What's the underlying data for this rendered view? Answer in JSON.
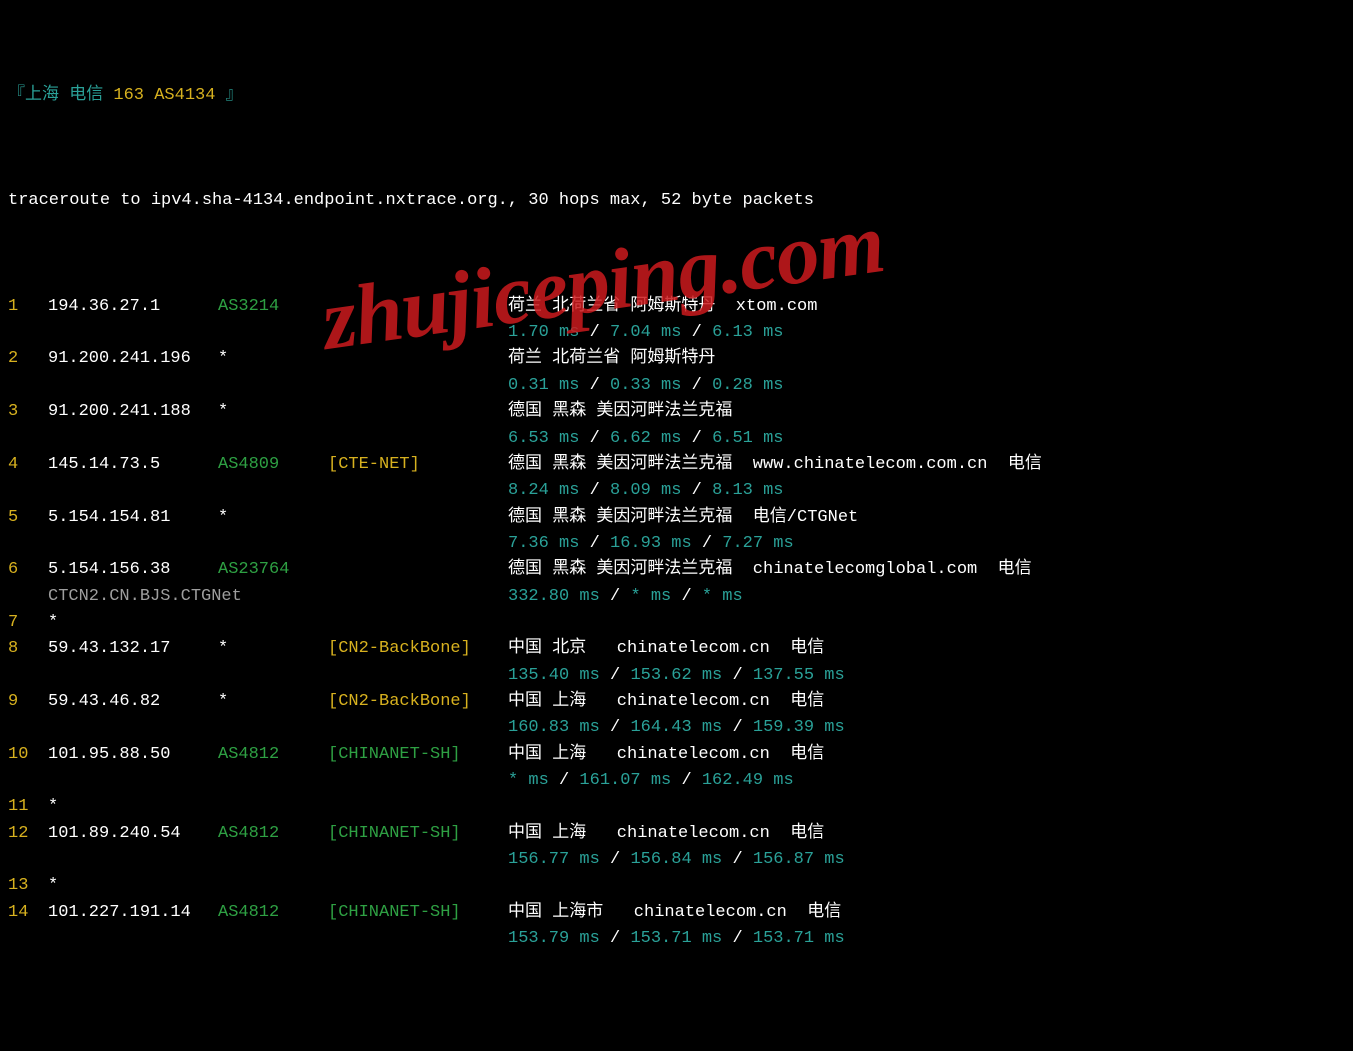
{
  "title_prefix": "『上海 电信 ",
  "title_as": "163 AS4134",
  "title_suffix": " 』",
  "trace_line": "traceroute to ipv4.sha-4134.endpoint.nxtrace.org., 30 hops max, 52 byte packets",
  "watermark": "zhujiceping.com",
  "hops": [
    {
      "n": "1",
      "ip": "194.36.27.1",
      "asn": "AS3214",
      "tag": "",
      "loc": "荷兰 北荷兰省 阿姆斯特丹  xtom.com",
      "lat": [
        "1.70 ms",
        "7.04 ms",
        "6.13 ms"
      ]
    },
    {
      "n": "2",
      "ip": "91.200.241.196",
      "asn": "*",
      "tag": "",
      "loc": "荷兰 北荷兰省 阿姆斯特丹",
      "lat": [
        "0.31 ms",
        "0.33 ms",
        "0.28 ms"
      ]
    },
    {
      "n": "3",
      "ip": "91.200.241.188",
      "asn": "*",
      "tag": "",
      "loc": "德国 黑森 美因河畔法兰克福",
      "lat": [
        "6.53 ms",
        "6.62 ms",
        "6.51 ms"
      ]
    },
    {
      "n": "4",
      "ip": "145.14.73.5",
      "asn": "AS4809",
      "tag": "[CTE-NET]",
      "loc": "德国 黑森 美因河畔法兰克福  www.chinatelecom.com.cn  电信",
      "lat": [
        "8.24 ms",
        "8.09 ms",
        "8.13 ms"
      ]
    },
    {
      "n": "5",
      "ip": "5.154.154.81",
      "asn": "*",
      "tag": "",
      "loc": "德国 黑森 美因河畔法兰克福  电信/CTGNet",
      "lat": [
        "7.36 ms",
        "16.93 ms",
        "7.27 ms"
      ]
    },
    {
      "n": "6",
      "ip": "5.154.156.38",
      "asn": "AS23764",
      "tag": "",
      "loc": "德国 黑森 美因河畔法兰克福  chinatelecomglobal.com  电信",
      "rdns": "CTCN2.CN.BJS.CTGNet",
      "lat": [
        "332.80 ms",
        "* ms",
        "* ms"
      ]
    },
    {
      "n": "7",
      "ip": "*",
      "asn": "",
      "tag": "",
      "loc": "",
      "lat": []
    },
    {
      "n": "8",
      "ip": "59.43.132.17",
      "asn": "*",
      "tag": "[CN2-BackBone]",
      "loc": "中国 北京   chinatelecom.cn  电信",
      "lat": [
        "135.40 ms",
        "153.62 ms",
        "137.55 ms"
      ]
    },
    {
      "n": "9",
      "ip": "59.43.46.82",
      "asn": "*",
      "tag": "[CN2-BackBone]",
      "loc": "中国 上海   chinatelecom.cn  电信",
      "lat": [
        "160.83 ms",
        "164.43 ms",
        "159.39 ms"
      ]
    },
    {
      "n": "10",
      "ip": "101.95.88.50",
      "asn": "AS4812",
      "tag": "[CHINANET-SH]",
      "loc": "中国 上海   chinatelecom.cn  电信",
      "lat": [
        "* ms",
        "161.07 ms",
        "162.49 ms"
      ]
    },
    {
      "n": "11",
      "ip": "*",
      "asn": "",
      "tag": "",
      "loc": "",
      "lat": []
    },
    {
      "n": "12",
      "ip": "101.89.240.54",
      "asn": "AS4812",
      "tag": "[CHINANET-SH]",
      "loc": "中国 上海   chinatelecom.cn  电信",
      "lat": [
        "156.77 ms",
        "156.84 ms",
        "156.87 ms"
      ]
    },
    {
      "n": "13",
      "ip": "*",
      "asn": "",
      "tag": "",
      "loc": "",
      "lat": []
    },
    {
      "n": "14",
      "ip": "101.227.191.14",
      "asn": "AS4812",
      "tag": "[CHINANET-SH]",
      "loc": "中国 上海市   chinatelecom.cn  电信",
      "lat": [
        "153.79 ms",
        "153.71 ms",
        "153.71 ms"
      ]
    }
  ]
}
